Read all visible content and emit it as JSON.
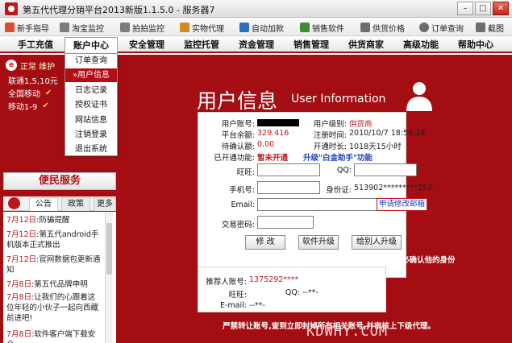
{
  "window": {
    "title": "第五代代理分销平台2013新版1.1.5.0 - 服务器7"
  },
  "toolbar": [
    {
      "label": "新手指导",
      "icon": "guide-icon",
      "color": "#e24b2a"
    },
    {
      "label": "淘宝监控",
      "icon": "taobao-arrow-icon",
      "color": "#7c7c7c"
    },
    {
      "label": "拍拍监控",
      "icon": "paipai-arrow-icon",
      "color": "#7c7c7c"
    },
    {
      "label": "实物代理",
      "icon": "cart-icon",
      "color": "#d08a1d"
    },
    {
      "label": "自动加款",
      "icon": "auto-deposit-icon",
      "color": "#2c6fbf"
    },
    {
      "label": "销售软件",
      "icon": "software-icon",
      "color": "#3b8f2e"
    },
    {
      "label": "供货价格",
      "icon": "price-icon",
      "color": "#6d6d6d"
    },
    {
      "label": "订单查询",
      "icon": "search-icon",
      "color": "#6d6d6d"
    },
    {
      "label": "截图",
      "icon": "screenshot-icon",
      "color": "#6d6d6d"
    }
  ],
  "nav": [
    "手工充值",
    "账户中心",
    "安全管理",
    "监控托管",
    "资金管理",
    "销售管理",
    "供货商家",
    "高级功能",
    "帮助中心"
  ],
  "dropdown": [
    "订单查询",
    "»用户信息",
    "日志记录",
    "授权证书",
    "网站信息",
    "注销登录",
    "退出系统"
  ],
  "status": {
    "head": "正常 维护",
    "lines": [
      "联通1,5,10元",
      "全国移动",
      "移动1-9"
    ]
  },
  "left_panel": {
    "service_title": "便民服务",
    "tabs": [
      "公告",
      "政策",
      "更多"
    ],
    "news": [
      {
        "date": "7月12日",
        "text": ":防骗提醒"
      },
      {
        "date": "7月12日",
        "text": ":第五代android手机版本正式推出"
      },
      {
        "date": "7月12日",
        "text": ":官网数据包更新通知"
      },
      {
        "date": "7月8日",
        "text": ":第五代品牌申明"
      },
      {
        "date": "7月8日",
        "text": ":让我们的心跟着这位年轻的小伙子一起向西藏前进吧!"
      },
      {
        "date": "7月8日",
        "text": ":软件客户端下载安全"
      }
    ]
  },
  "user_info": {
    "title_cn": "用户信息",
    "title_en": "User Information",
    "account_label": "用户账号:",
    "level_label": "用户级别:",
    "level_value": "供货商",
    "balance_label": "平台余额:",
    "balance_value": "329.416",
    "reg_time_label": "注册时间:",
    "reg_time_value": "2010/10/7 18:58:38",
    "pending_label": "待确认额:",
    "pending_value": "0.00",
    "duration_label": "开通时长:",
    "duration_value": "1018天15小时",
    "feature_label": "已开通功能:",
    "feature_value": "暂未开通",
    "upgrade_text": "升级\"白金助手\"功能",
    "wangwang_label": "旺旺:",
    "qq_label": "QQ:",
    "phone_label": "手机号:",
    "id_label": "身份证:",
    "id_value": "513902*********152",
    "email_label": "Email:",
    "email_link": "申请修改邮箱",
    "txpwd_label": "交易密码:",
    "buttons": [
      "修  改",
      "软件升级",
      "给别人升级"
    ]
  },
  "warning1": "防骗警告:陌生人让你修改邮箱、和你远程等,可能是骗子,务必确认他的身份",
  "referrer": {
    "account_label": "推荐人账号:",
    "account_value": "1375292****",
    "wangwang_label": "旺旺:",
    "qq_label": "QQ:",
    "qq_value": "--**-",
    "email_label": "E-mail:",
    "email_value": "--**-"
  },
  "warning2": "严禁转让账号,查到立即封掉所有相关账号,并审核上下级代理。",
  "watermark": "KDWHY.COM"
}
